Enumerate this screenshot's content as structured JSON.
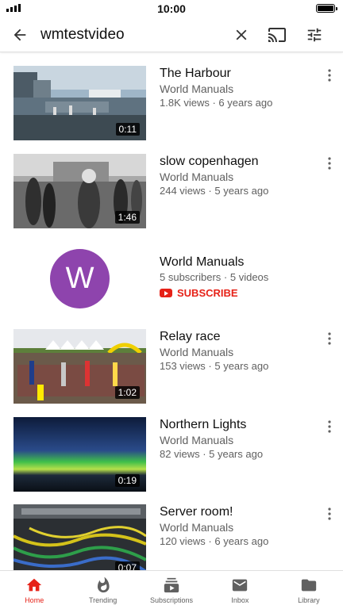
{
  "status_bar": {
    "time": "10:00"
  },
  "search": {
    "query": "wmtestvideo"
  },
  "results": [
    {
      "title": "The Harbour",
      "channel": "World Manuals",
      "stats": "1.8K views · 6 years ago",
      "duration": "0:11"
    },
    {
      "title": "slow copenhagen",
      "channel": "World Manuals",
      "stats": "244 views · 5 years ago",
      "duration": "1:46"
    }
  ],
  "channel_card": {
    "avatar_letter": "W",
    "name": "World Manuals",
    "stats": "5 subscribers · 5 videos",
    "subscribe_label": "SUBSCRIBE",
    "avatar_color": "#8e44ad"
  },
  "more_results": [
    {
      "title": "Relay race",
      "channel": "World Manuals",
      "stats": "153 views · 5 years ago",
      "duration": "1:02"
    },
    {
      "title": "Northern Lights",
      "channel": "World Manuals",
      "stats": "82 views · 5 years ago",
      "duration": "0:19"
    },
    {
      "title": "Server room!",
      "channel": "World Manuals",
      "stats": "120 views · 6 years ago",
      "duration": "0:07"
    }
  ],
  "bottom_nav": [
    {
      "label": "Home",
      "icon": "home-icon",
      "active": true
    },
    {
      "label": "Trending",
      "icon": "flame-icon",
      "active": false
    },
    {
      "label": "Subscriptions",
      "icon": "subscriptions-icon",
      "active": false
    },
    {
      "label": "Inbox",
      "icon": "mail-icon",
      "active": false
    },
    {
      "label": "Library",
      "icon": "folder-icon",
      "active": false
    }
  ],
  "colors": {
    "accent": "#e62117",
    "text_secondary": "#606060"
  }
}
